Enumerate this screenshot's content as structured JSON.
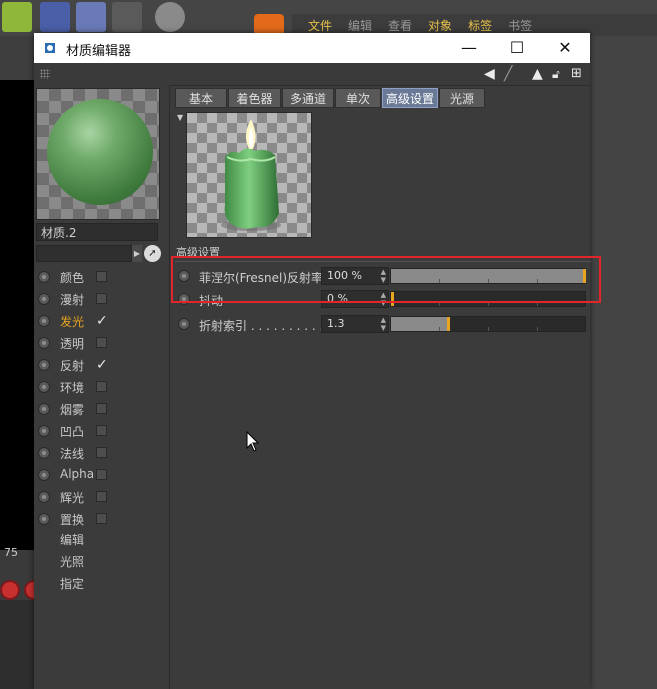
{
  "app_menu": {
    "items": [
      "文件",
      "编辑",
      "查看",
      "对象",
      "标签",
      "书签"
    ]
  },
  "background": {
    "frame_value": "75"
  },
  "dialog": {
    "title": "材质编辑器",
    "window_buttons": {
      "minimize": "—",
      "maximize": "☐",
      "close": "✕"
    }
  },
  "material": {
    "name": "材质.2"
  },
  "channels": [
    {
      "label": "颜色",
      "checked": false,
      "active": false
    },
    {
      "label": "漫射",
      "checked": false,
      "active": false
    },
    {
      "label": "发光",
      "checked": true,
      "active": true
    },
    {
      "label": "透明",
      "checked": false,
      "active": false
    },
    {
      "label": "反射",
      "checked": true,
      "active": false
    },
    {
      "label": "环境",
      "checked": false,
      "active": false
    },
    {
      "label": "烟雾",
      "checked": false,
      "active": false
    },
    {
      "label": "凹凸",
      "checked": false,
      "active": false
    },
    {
      "label": "法线",
      "checked": false,
      "active": false
    },
    {
      "label": "Alpha",
      "checked": false,
      "active": false
    },
    {
      "label": "辉光",
      "checked": false,
      "active": false
    },
    {
      "label": "置换",
      "checked": false,
      "active": false
    }
  ],
  "extra_items": [
    "编辑",
    "光照",
    "指定"
  ],
  "tabs": [
    {
      "label": "基本",
      "active": false
    },
    {
      "label": "着色器",
      "active": false
    },
    {
      "label": "多通道",
      "active": false
    },
    {
      "label": "单次",
      "active": false
    },
    {
      "label": "高级设置",
      "active": true
    },
    {
      "label": "光源",
      "active": false
    }
  ],
  "section": {
    "title": "高级设置"
  },
  "properties": [
    {
      "label": "菲涅尔(Fresnel)反射率",
      "value": "100 %",
      "level": 1.0
    },
    {
      "label": "抖动",
      "value": "0 %",
      "level": 0.0
    },
    {
      "label": "折射索引 . . . . . . . . . . .",
      "value": "1.3",
      "level": 0.3
    }
  ],
  "colors": {
    "accent": "#e8a520",
    "highlight_box": "#e0262a",
    "active_tab": "#6a7a96"
  }
}
